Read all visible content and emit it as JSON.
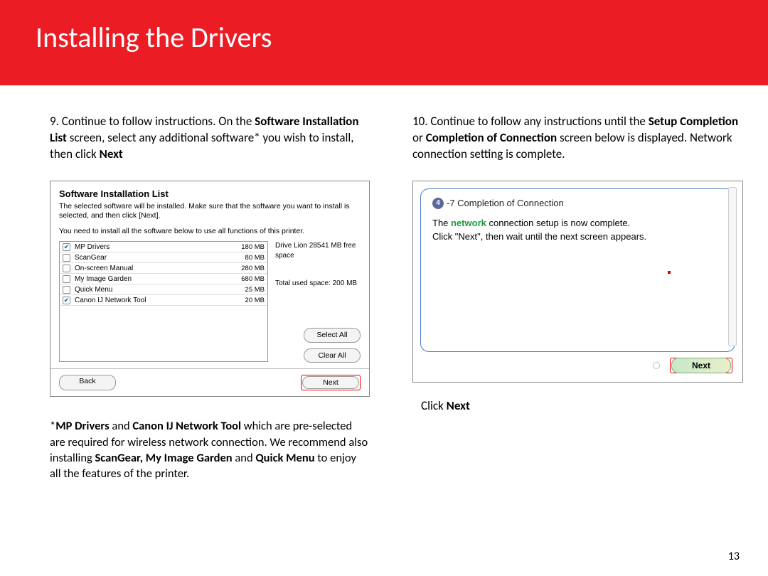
{
  "header": {
    "title": "Installing  the Drivers"
  },
  "left": {
    "step_num": "9",
    "step_pre": ". Continue to follow instructions.  On the ",
    "step_b1": "Software Installation List",
    "step_mid": " screen, select any additional software* you wish to install, then click ",
    "step_b2": "Next",
    "dialog": {
      "title": "Software Installation List",
      "desc": "The selected software will be installed. Make sure that the software you want to install is selected, and then click [Next].",
      "sub": "You need to install all the software below to use all functions of this printer.",
      "items": [
        {
          "checked": true,
          "name": "MP Drivers",
          "size": "180 MB"
        },
        {
          "checked": false,
          "name": "ScanGear",
          "size": "80 MB"
        },
        {
          "checked": false,
          "name": "On-screen Manual",
          "size": "280 MB"
        },
        {
          "checked": false,
          "name": "My Image Garden",
          "size": "680 MB"
        },
        {
          "checked": false,
          "name": "Quick Menu",
          "size": "25 MB"
        },
        {
          "checked": true,
          "name": "Canon IJ Network Tool",
          "size": "20 MB"
        }
      ],
      "free_space": "Drive Lion 28541 MB free space",
      "used_space": "Total used space: 200 MB",
      "select_all": "Select All",
      "clear_all": "Clear All",
      "back": "Back",
      "next": "Next"
    },
    "footnote_pre": "*",
    "footnote_b1": "MP Drivers",
    "footnote_mid1": " and ",
    "footnote_b2": "Canon IJ Network Tool",
    "footnote_mid2": " which are pre-selected are required for wireless network connection.  We recommend also installing ",
    "footnote_b3": "ScanGear, My Image Garden",
    "footnote_mid3": " and ",
    "footnote_b4": "Quick Menu",
    "footnote_end": " to enjoy all the features of the printer."
  },
  "right": {
    "step_num": "10",
    "step_pre": ". Continue to follow any instructions until the ",
    "step_b1": "Setup Completion",
    "step_mid": " or ",
    "step_b2": "Completion of Connection",
    "step_end": " screen below is displayed. Network connection setting is complete.",
    "comp": {
      "step_badge": "4",
      "step_suffix": "-7 Completion of Connection",
      "line1_pre": "The ",
      "line1_green": "network",
      "line1_post": " connection setup is now complete.",
      "line2": "Click \"Next\", then wait until the next screen appears.",
      "next": "Next"
    },
    "click_next_pre": "Click ",
    "click_next_b": "Next"
  },
  "page_number": "13"
}
